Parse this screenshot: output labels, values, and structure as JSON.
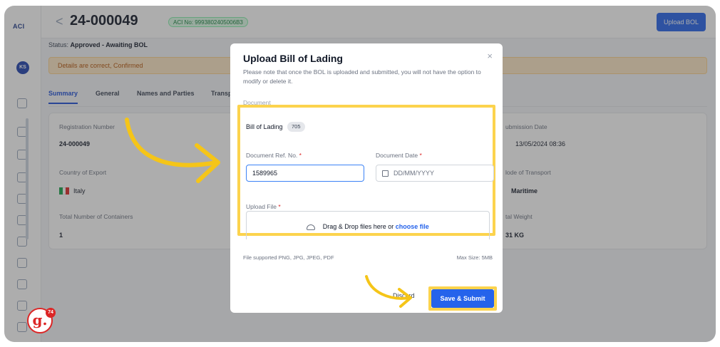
{
  "rail": {
    "logo": "ACI",
    "avatar": "KS"
  },
  "header": {
    "back_glyph": "<",
    "title": "24-000049",
    "aci_badge": "ACI No: 9993802405006B3",
    "upload_button": "Upload BOL"
  },
  "status": {
    "prefix": "Status:",
    "value": "Approved - Awaiting BOL"
  },
  "alert": "Details are correct, Confirmed",
  "tabs": [
    "Summary",
    "General",
    "Names and Parties",
    "Transp"
  ],
  "summary": {
    "registration_label": "Registration Number",
    "registration_value": "24-000049",
    "country_label": "Country of Export",
    "country_value": "Italy",
    "containers_label": "Total Number of Containers",
    "containers_value": "1",
    "submission_label": "ubmission Date",
    "submission_value": "13/05/2024 08:36",
    "transport_label": "lode of Transport",
    "transport_value": "Maritime",
    "weight_label": "tal Weight",
    "weight_value": "31 KG"
  },
  "modal": {
    "title": "Upload Bill of Lading",
    "close_glyph": "×",
    "note": "Please note that once the BOL is uploaded and submitted, you will not have the option to modify or delete it.",
    "section_label": "Document",
    "bol_label": "Bill of Lading",
    "bol_pill": "705",
    "ref_label": "Document Ref. No.",
    "ref_value": "1589965",
    "date_label": "Document Date",
    "date_placeholder": "DD/MM/YYYY",
    "required_mark": "*",
    "upload_label": "Upload File",
    "drop_text": "Drag & Drop files here or",
    "choose_file": "choose file",
    "supported": "File supported PNG, JPG, JPEG, PDF",
    "max_size": "Max Size: 5MB",
    "discard": "Discard",
    "submit": "Save & Submit"
  },
  "brand": {
    "logo_letter": "g.",
    "badge": "74"
  },
  "colors": {
    "primary": "#2563eb",
    "highlight": "#fcd34d",
    "alert_bg": "#fde7c5",
    "success": "#15803d"
  },
  "icons": [
    "close-icon",
    "calendar-icon",
    "cloud-upload-icon",
    "flag-icon",
    "back-icon",
    "tutorial-arrow"
  ]
}
